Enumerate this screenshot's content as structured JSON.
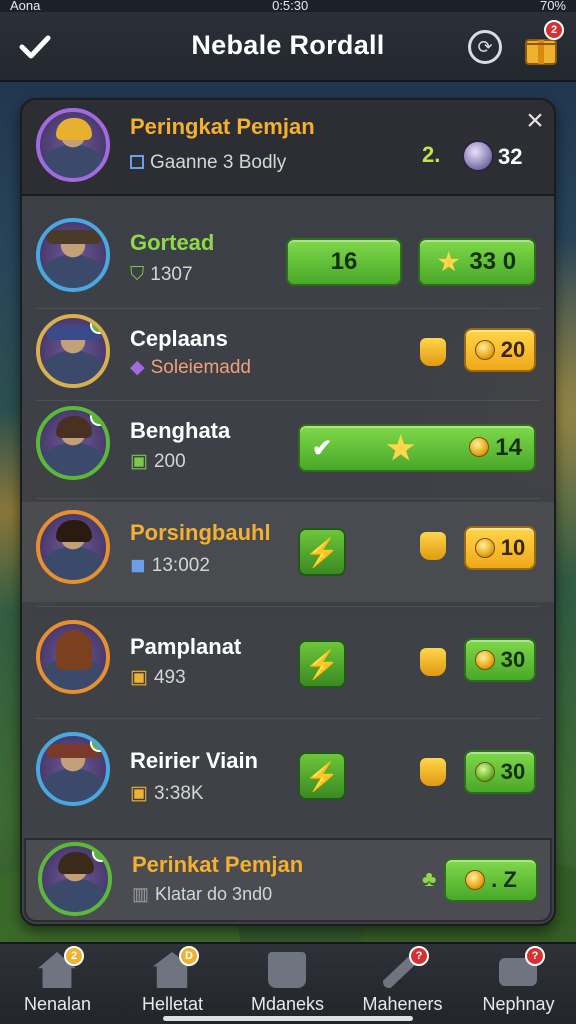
{
  "status_bar": {
    "carrier": "Aona",
    "time": "0:5:30",
    "battery": "70%"
  },
  "header": {
    "title": "Nebale Rordall",
    "gift_badge": "2"
  },
  "panel": {
    "title": "Peringkat Pemjan",
    "subtitle": "Gaanne 3 Bodly",
    "rank": "2.",
    "coins": "32"
  },
  "players": [
    {
      "name": "Gortead",
      "name_color": "#8fd848",
      "stat": "1307",
      "stat_color": "#d5d5d5",
      "main_value": "16",
      "side_value": "33 0",
      "action": "green-value"
    },
    {
      "name": "Ceplaans",
      "name_color": "#ffffff",
      "stat": "Soleiemadd",
      "stat_color": "#f0a07a",
      "side_value": "20",
      "action": "trophy"
    },
    {
      "name": "Benghata",
      "name_color": "#ffffff",
      "stat": "200",
      "stat_color": "#d5d5d5",
      "side_value": "14",
      "action": "progress"
    },
    {
      "name": "Porsingbauhl",
      "name_color": "#f4b030",
      "stat": "13:002",
      "stat_color": "#d5d5d5",
      "side_value": "10",
      "action": "bolt"
    },
    {
      "name": "Pamplanat",
      "name_color": "#ffffff",
      "stat": "493",
      "stat_color": "#d5d5d5",
      "side_value": "30",
      "action": "bolt"
    },
    {
      "name": "Reirier Viain",
      "name_color": "#ffffff",
      "stat": "3:38K",
      "stat_color": "#d5d5d5",
      "side_value": "30",
      "action": "bolt"
    }
  ],
  "self_row": {
    "name": "Perinkat Pemjan",
    "stat": "Klatar do 3nd0",
    "value": ". Z"
  },
  "bottom_nav": [
    {
      "label": "Nenalan",
      "badge": "2"
    },
    {
      "label": "Helletat",
      "badge": "D"
    },
    {
      "label": "Mdaneks",
      "badge": ""
    },
    {
      "label": "Maheners",
      "badge": "?"
    },
    {
      "label": "Nephnay",
      "badge": "?"
    }
  ],
  "colors": {
    "accent_green": "#6cc63a",
    "accent_gold": "#f4b030",
    "panel": "#3e4046"
  }
}
